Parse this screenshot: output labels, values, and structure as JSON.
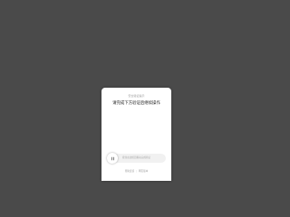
{
  "dialog": {
    "subtitle": "安全验证提示",
    "title": "请完成下方验证后继续操作",
    "slider": {
      "hint": "按住左边按钮拖动完成验证",
      "handle_icon": "pause-icon"
    },
    "footer": {
      "links": [
        "帮助反馈",
        "网页版本"
      ],
      "separator": "|"
    }
  },
  "colors": {
    "overlay": "#4a4a4a",
    "dialog_background": "#ffffff",
    "track_background": "#f1f1f1",
    "title_text": "#222222",
    "muted_text": "#9a9a9a"
  }
}
